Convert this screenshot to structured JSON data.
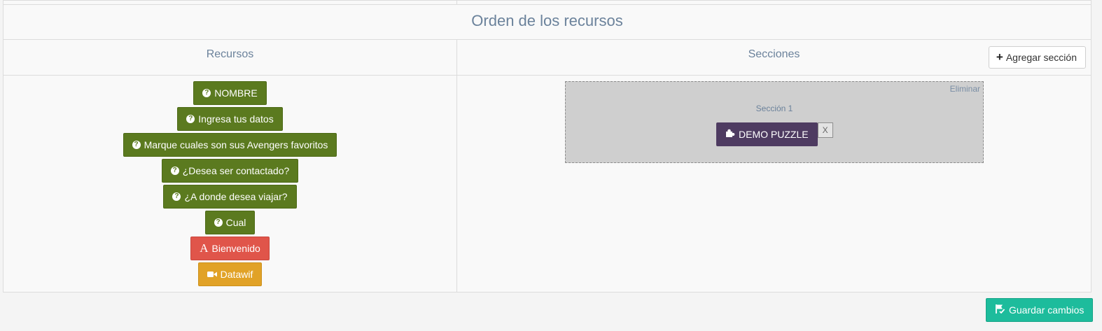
{
  "title": "Orden de los recursos",
  "columns": {
    "left_title": "Recursos",
    "right_title": "Secciones",
    "add_section_label": "Agregar sección"
  },
  "resources": [
    {
      "label": "NOMBRE",
      "icon": "question-circle-icon",
      "color": "#5b7a1f"
    },
    {
      "label": "Ingresa tus datos",
      "icon": "question-circle-icon",
      "color": "#5b7a1f"
    },
    {
      "label": "Marque cuales son sus Avengers favoritos",
      "icon": "question-circle-icon",
      "color": "#5b7a1f"
    },
    {
      "label": "¿Desea ser contactado?",
      "icon": "question-circle-icon",
      "color": "#5b7a1f"
    },
    {
      "label": "¿A donde desea viajar?",
      "icon": "question-circle-icon",
      "color": "#5b7a1f"
    },
    {
      "label": "Cual",
      "icon": "question-circle-icon",
      "color": "#5b7a1f"
    },
    {
      "label": "Bienvenido",
      "icon": "font-icon",
      "color": "#e0554a"
    },
    {
      "label": "Datawif",
      "icon": "video-camera-icon",
      "color": "#e1a227"
    }
  ],
  "sections": [
    {
      "name": "Sección 1",
      "delete_label": "Eliminar",
      "items": [
        {
          "label": "DEMO PUZZLE",
          "icon": "puzzle-icon",
          "remove_label": "X",
          "color": "#4e3b61"
        }
      ]
    }
  ],
  "footer": {
    "save_label": "Guardar cambios",
    "save_color": "#1dbc9c"
  }
}
